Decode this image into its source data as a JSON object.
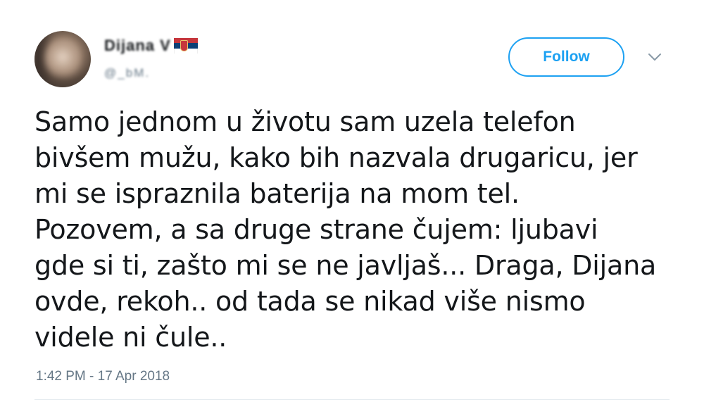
{
  "user": {
    "display_name": "Dijana V",
    "handle": "@_bM."
  },
  "follow_button": {
    "label": "Follow"
  },
  "tweet": {
    "text": "Samo jednom u životu sam uzela telefon\nbivšem mužu, kako bih nazvala drugaricu, jer\nmi se ispraznila baterija na mom tel.\nPozovem, a sa druge strane čujem: ljubavi\ngde si ti, zašto mi se ne javljaš... Draga, Dijana\novde, rekoh.. od tada se nikad više nismo\nvidele ni čule..",
    "timestamp": "1:42 PM - 17 Apr 2018"
  },
  "icons": {
    "flag": "serbia-flag-icon",
    "menu": "chevron-down-icon"
  },
  "colors": {
    "accent": "#1da1f2",
    "text": "#14171a",
    "muted": "#657786"
  }
}
